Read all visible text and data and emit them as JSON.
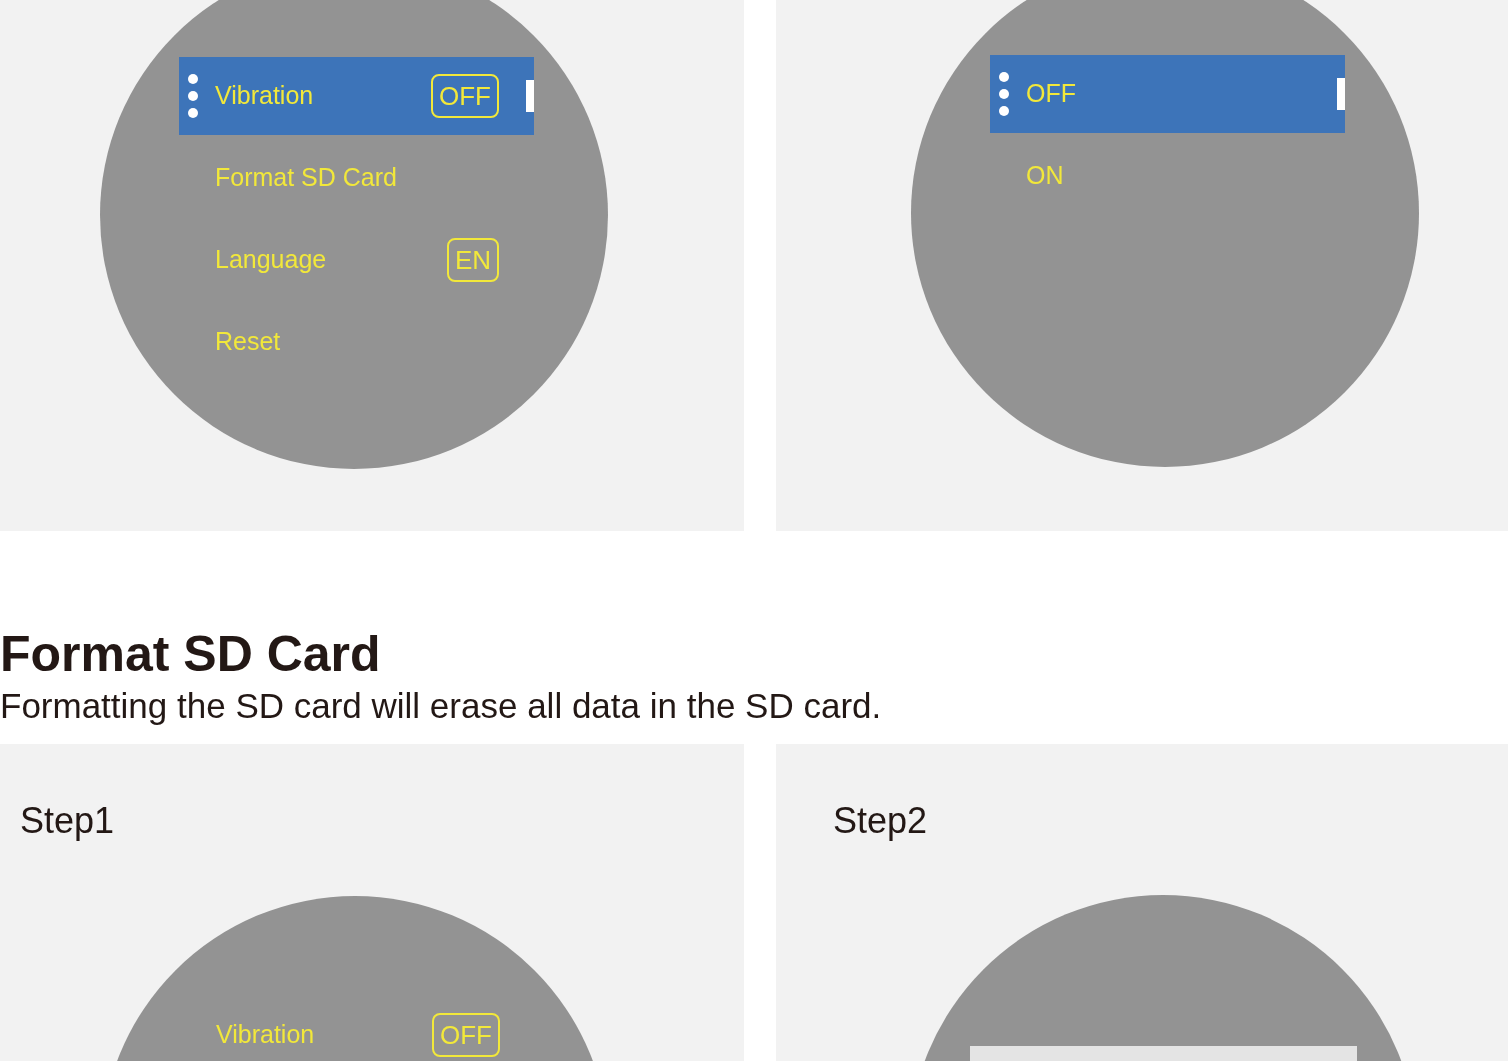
{
  "top_screens": [
    {
      "kind": "menu",
      "items": [
        {
          "label": "Vibration",
          "badge": "OFF",
          "selected": true
        },
        {
          "label": "Format SD Card",
          "selected": false
        },
        {
          "label": "Language",
          "badge": "EN",
          "selected": false
        },
        {
          "label": "Reset",
          "selected": false
        }
      ]
    },
    {
      "kind": "menu",
      "items": [
        {
          "label": "OFF",
          "selected": true
        },
        {
          "label": "ON",
          "selected": false
        }
      ]
    }
  ],
  "section": {
    "title": "Format SD Card",
    "description": "Formatting the SD card will erase all data in the SD card."
  },
  "steps": [
    {
      "label": "Step1",
      "screen": {
        "kind": "menu",
        "items": [
          {
            "label": "Vibration",
            "badge": "OFF",
            "selected": false
          }
        ]
      }
    },
    {
      "label": "Step2",
      "screen": {
        "kind": "dialog"
      }
    }
  ]
}
